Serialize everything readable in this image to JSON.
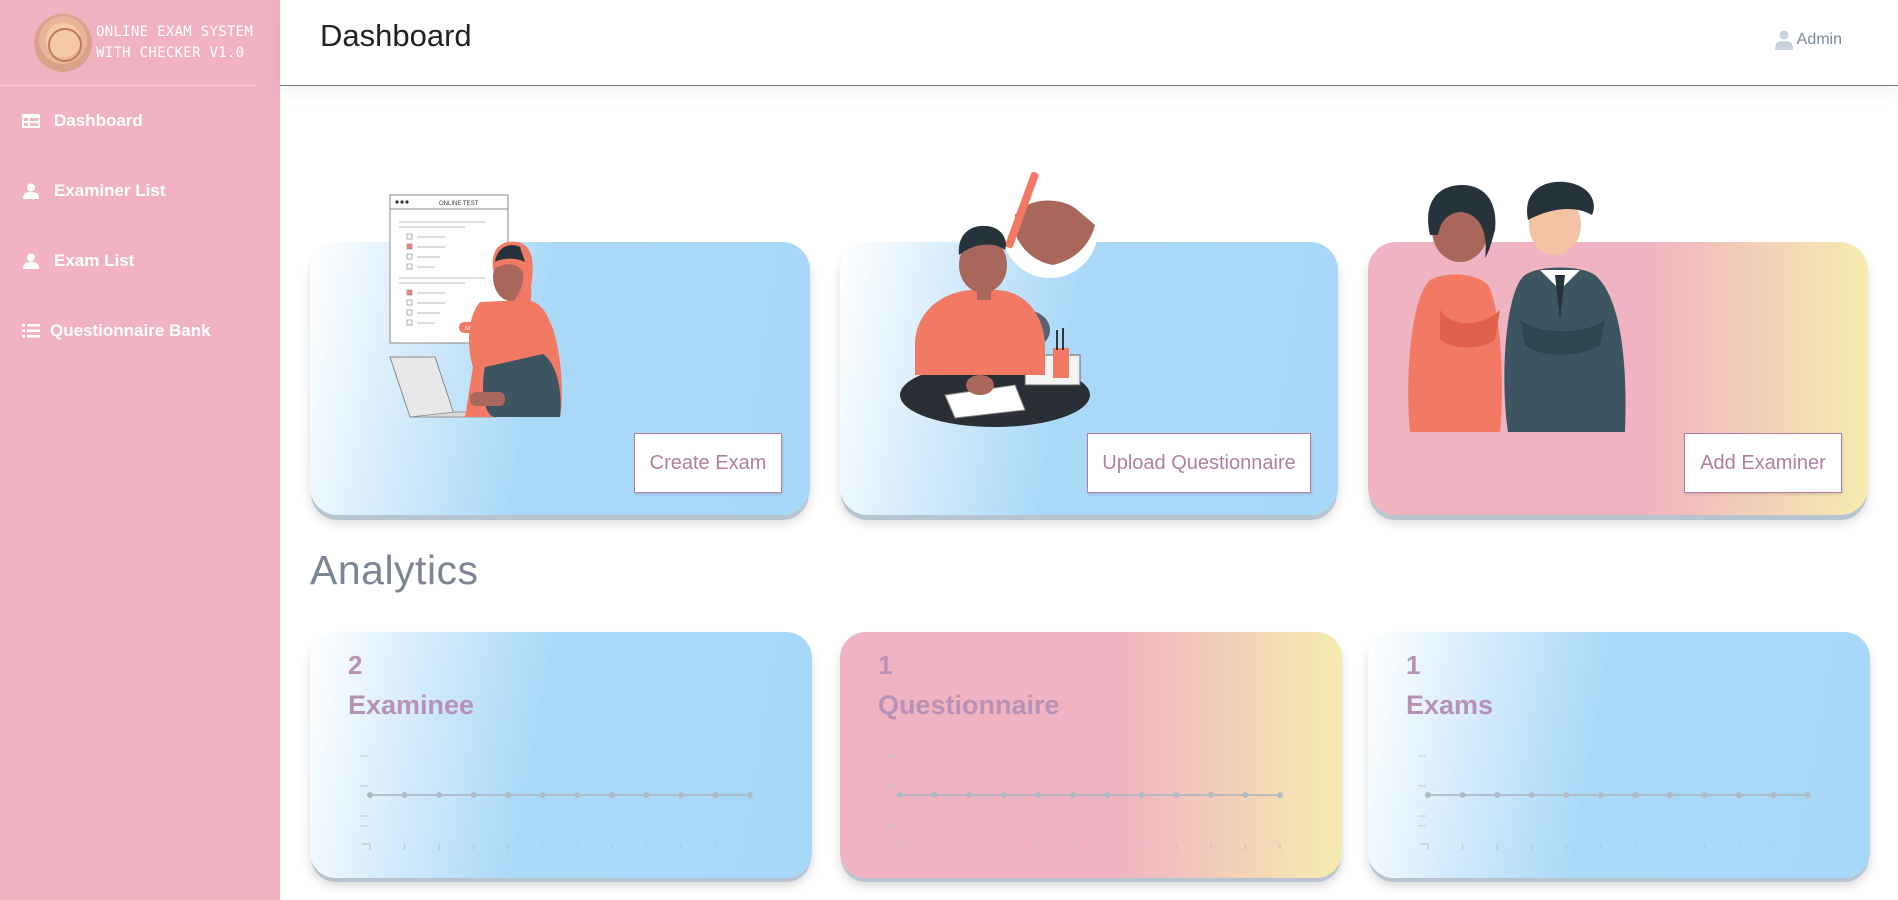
{
  "sidebar": {
    "brand_line1": "ONLINE EXAM SYSTEM",
    "brand_line2": "WITH CHECKER V1.0",
    "items": [
      {
        "label": "Dashboard",
        "icon": "table-icon"
      },
      {
        "label": "Examiner List",
        "icon": "user-icon"
      },
      {
        "label": "Exam List",
        "icon": "user-icon"
      },
      {
        "label": "Questionnaire Bank",
        "icon": "list-icon"
      }
    ],
    "color": "#f1b3c2"
  },
  "header": {
    "title": "Dashboard",
    "user_label": "Admin"
  },
  "actions": [
    {
      "label": "Create Exam"
    },
    {
      "label": "Upload Questionnaire"
    },
    {
      "label": "Add Examiner"
    }
  ],
  "illustration_text": {
    "test_header": "ONLINE TEST",
    "next_button": "NEXT"
  },
  "analytics": {
    "title": "Analytics",
    "cards": [
      {
        "value": "2",
        "label": "Examinee"
      },
      {
        "value": "1",
        "label": "Questionnaire"
      },
      {
        "value": "1",
        "label": "Exams"
      }
    ]
  },
  "colors": {
    "accent_text": "#b892b6",
    "button_text": "#b07f9f",
    "card_blue": "#a8d8f8",
    "card_pink": "#efb3c1",
    "card_yellow": "#f5ebb0"
  }
}
